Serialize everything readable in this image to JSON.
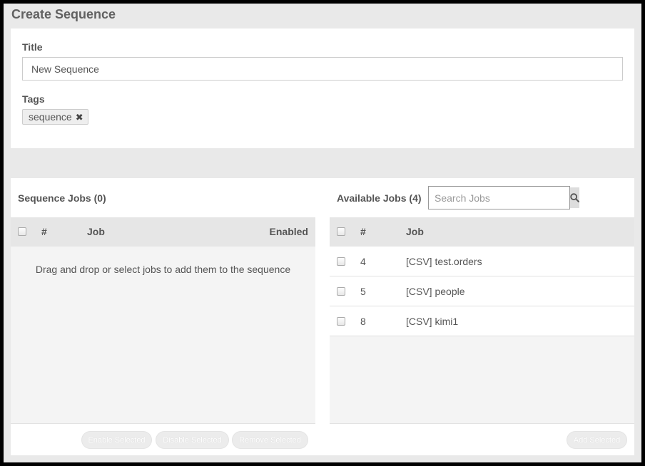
{
  "page": {
    "title": "Create Sequence"
  },
  "form": {
    "title_label": "Title",
    "title_value": "New Sequence",
    "tags_label": "Tags",
    "tags": [
      {
        "label": "sequence"
      }
    ]
  },
  "sequence_jobs": {
    "heading": "Sequence Jobs (0)",
    "columns": {
      "num": "#",
      "job": "Job",
      "enabled": "Enabled"
    },
    "empty_message": "Drag and drop or select jobs to add them to the sequence",
    "buttons": {
      "enable": "Enable Selected",
      "disable": "Disable Selected",
      "remove": "Remove Selected"
    }
  },
  "available_jobs": {
    "heading": "Available Jobs (4)",
    "search_placeholder": "Search Jobs",
    "columns": {
      "num": "#",
      "job": "Job"
    },
    "rows": [
      {
        "num": "4",
        "job": "[CSV] test.orders"
      },
      {
        "num": "5",
        "job": "[CSV] people"
      },
      {
        "num": "8",
        "job": "[CSV] kimi1"
      }
    ],
    "buttons": {
      "add": "Add Selected"
    }
  },
  "icons": {
    "tag_remove": "close-icon",
    "search": "search-icon"
  }
}
